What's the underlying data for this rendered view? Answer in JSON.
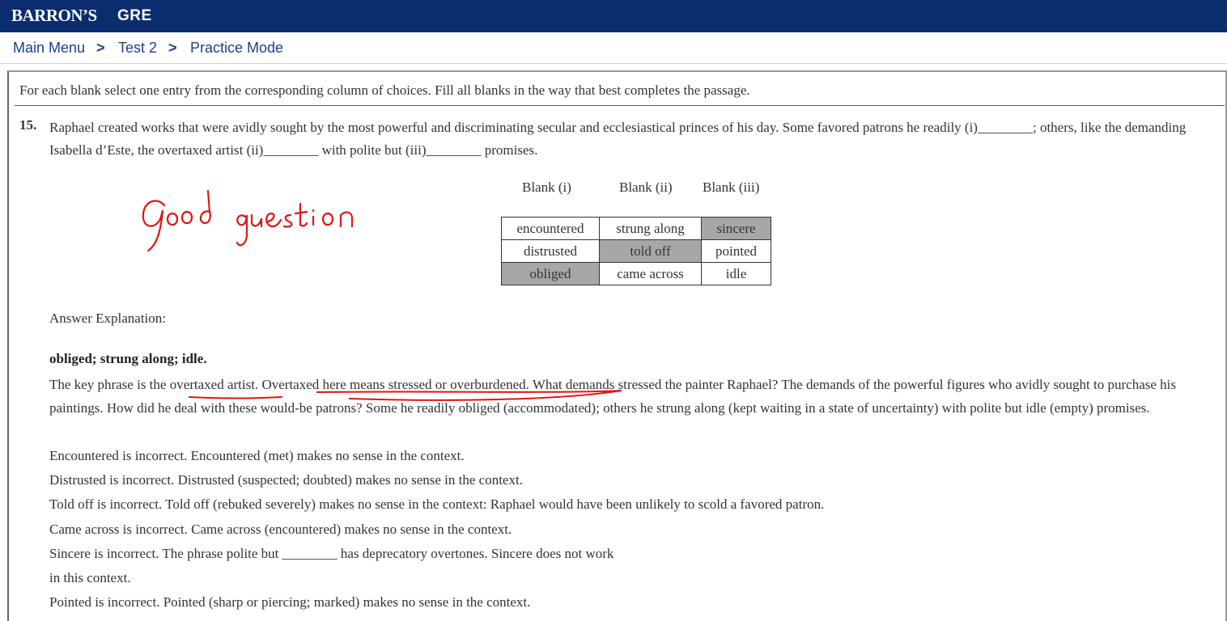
{
  "header": {
    "brand": "BARRON’S",
    "product": "GRE"
  },
  "breadcrumb": {
    "items": [
      "Main Menu",
      "Test 2",
      "Practice Mode"
    ],
    "separator": ">"
  },
  "directions": "For each blank select one entry from the corresponding column of choices. Fill all blanks in the way that best completes the passage.",
  "question": {
    "number": "15.",
    "text": "Raphael created works that were avidly sought by the most powerful and discriminating secular and ecclesiastical princes of his day. Some favored patrons he readily (i)________; others, like the demanding Isabella d’Este, the overtaxed artist (ii)________ with polite but (iii)________ promises.",
    "blank_headers": [
      "Blank (i)",
      "Blank (ii)",
      "Blank (iii)"
    ],
    "rows": [
      [
        "encountered",
        "strung along",
        "sincere"
      ],
      [
        "distrusted",
        "told off",
        "pointed"
      ],
      [
        "obliged",
        "came across",
        "idle"
      ]
    ],
    "selected_cells": [
      "sincere",
      "told off",
      "obliged"
    ]
  },
  "annotation": {
    "handwriting": "Good question",
    "ink_color": "#e01515"
  },
  "explanation": {
    "label": "Answer Explanation:",
    "answer": "obliged; strung along; idle.",
    "lines": [
      "Encountered is incorrect. Encountered (met) makes no sense in the context.",
      "Distrusted is incorrect. Distrusted (suspected; doubted) makes no sense in the context.",
      "Told off is incorrect. Told off (rebuked severely) makes no sense in the context: Raphael would have been unlikely to scold a favored patron.",
      "Came across is incorrect. Came across (encountered) makes no sense in the context.",
      "Sincere is incorrect. The phrase polite but ________ has deprecatory overtones. Sincere does not work",
      "in this context.",
      "Pointed is incorrect. Pointed (sharp or piercing; marked) makes no sense in the context."
    ],
    "paragraph": "The key phrase is the overtaxed artist. Overtaxed here means stressed or overburdened. What demands stressed the painter Raphael? The demands of the powerful figures who avidly sought to purchase his paintings. How did he deal with these would-be patrons? Some he readily obliged (accommodated); others he strung along (kept waiting in a state of uncertainty) with polite but idle (empty) promises."
  }
}
